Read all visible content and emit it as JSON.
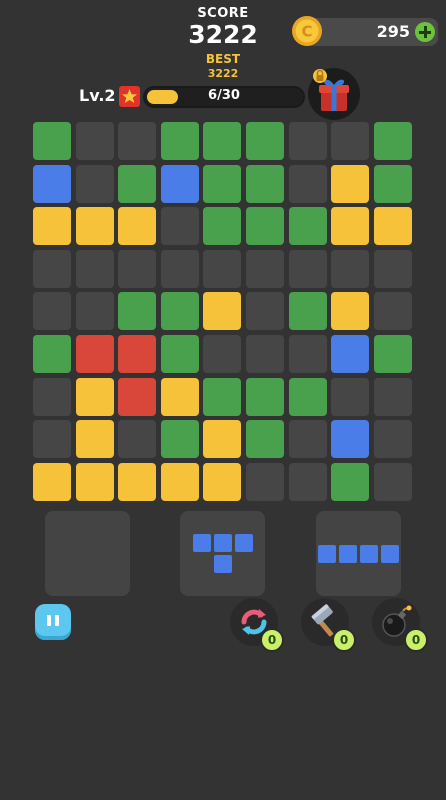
{
  "header": {
    "score_label": "SCORE",
    "score_value": "3222",
    "best_label": "BEST",
    "best_value": "3222"
  },
  "coins": {
    "amount": "295",
    "coin_symbol": "C",
    "icon": "coin-icon",
    "add_icon": "plus-icon"
  },
  "level": {
    "label": "Lv.2",
    "progress_text": "6/30",
    "progress_fraction": 0.2,
    "star_icon": "star-icon",
    "reward_icon": "gift-icon"
  },
  "colors": {
    "empty": "#464646",
    "green": "#4aa14d",
    "blue": "#4a7de8",
    "yellow": "#f5c23a",
    "red": "#d9473b"
  },
  "board": {
    "rows": [
      [
        "green",
        "empty",
        "empty",
        "green",
        "green",
        "green",
        "empty",
        "empty",
        "green"
      ],
      [
        "blue",
        "empty",
        "green",
        "blue",
        "green",
        "green",
        "empty",
        "yellow",
        "green"
      ],
      [
        "yellow",
        "yellow",
        "yellow",
        "empty",
        "green",
        "green",
        "green",
        "yellow",
        "yellow"
      ],
      [
        "empty",
        "empty",
        "empty",
        "empty",
        "empty",
        "empty",
        "empty",
        "empty",
        "empty"
      ],
      [
        "empty",
        "empty",
        "green",
        "green",
        "yellow",
        "empty",
        "green",
        "yellow",
        "empty"
      ],
      [
        "green",
        "red",
        "red",
        "green",
        "empty",
        "empty",
        "empty",
        "blue",
        "green"
      ],
      [
        "empty",
        "yellow",
        "red",
        "yellow",
        "green",
        "green",
        "green",
        "empty",
        "empty"
      ],
      [
        "empty",
        "yellow",
        "empty",
        "green",
        "yellow",
        "green",
        "empty",
        "blue",
        "empty"
      ],
      [
        "yellow",
        "yellow",
        "yellow",
        "yellow",
        "yellow",
        "empty",
        "empty",
        "green",
        "empty"
      ]
    ]
  },
  "pieces": [
    {
      "name": "empty-tray",
      "cells": []
    },
    {
      "name": "t-piece",
      "color": "blue",
      "cells": [
        [
          0,
          0
        ],
        [
          0,
          1
        ],
        [
          0,
          2
        ],
        [
          1,
          1
        ]
      ]
    },
    {
      "name": "i-piece",
      "color": "blue",
      "cells": [
        [
          0,
          0
        ],
        [
          0,
          1
        ],
        [
          0,
          2
        ],
        [
          0,
          3
        ]
      ]
    }
  ],
  "controls": {
    "pause_icon": "pause-icon",
    "tools": [
      {
        "name": "shuffle",
        "icon": "shuffle-icon",
        "count": "0"
      },
      {
        "name": "hammer",
        "icon": "hammer-icon",
        "count": "0"
      },
      {
        "name": "bomb",
        "icon": "bomb-icon",
        "count": "0"
      }
    ]
  }
}
